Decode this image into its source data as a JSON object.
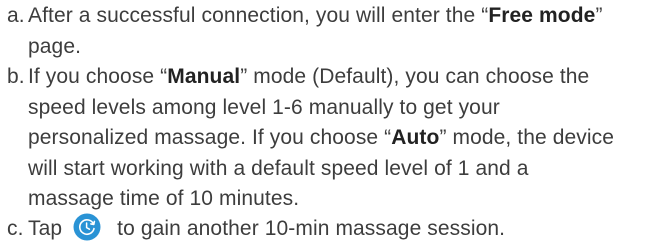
{
  "items": {
    "a": {
      "marker": "a.",
      "text1": "After a successful connection, you will enter the “",
      "bold": "Free mode",
      "text2": "”",
      "text3": "page."
    },
    "b": {
      "marker": "b.",
      "text1": "If you choose “",
      "bold1": "Manual",
      "text2": "” mode (Default), you can choose the",
      "text3": "speed levels among level 1-6 manually to get your",
      "text4": "personalized massage. If you choose “",
      "bold2": "Auto",
      "text5": "” mode, the device",
      "text6": "will start working with a default speed level of 1 and a",
      "text7": "massage time of 10 minutes."
    },
    "c": {
      "marker": "c.",
      "text1": "Tap",
      "icon": "refresh-timer-icon",
      "text2": "to gain another 10-min massage session."
    }
  },
  "colors": {
    "text": "#3d3d3d",
    "icon_fill": "#2a93d5",
    "icon_stroke": "#ffffff"
  }
}
